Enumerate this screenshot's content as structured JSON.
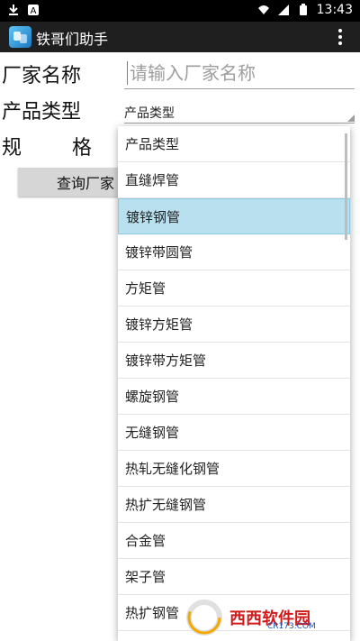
{
  "status_bar": {
    "time": "13:43"
  },
  "app_bar": {
    "title": "铁哥们助手"
  },
  "form": {
    "manufacturer_label": "厂家名称",
    "manufacturer_placeholder": "请输入厂家名称",
    "product_type_label": "产品类型",
    "product_type_selected": "产品类型",
    "spec_label_1": "规",
    "spec_label_2": "格",
    "query_button": "查询厂家"
  },
  "dropdown": {
    "items": [
      "产品类型",
      "直缝焊管",
      "镀锌钢管",
      "镀锌带圆管",
      "方矩管",
      "镀锌方矩管",
      "镀锌带方矩管",
      "螺旋钢管",
      "无缝钢管",
      "热轧无缝化钢管",
      "热扩无缝钢管",
      "合金管",
      "架子管",
      "热扩钢管"
    ],
    "selected_index": 2
  },
  "watermark": {
    "text": "西西软件园",
    "sub": "CR173.COM"
  }
}
